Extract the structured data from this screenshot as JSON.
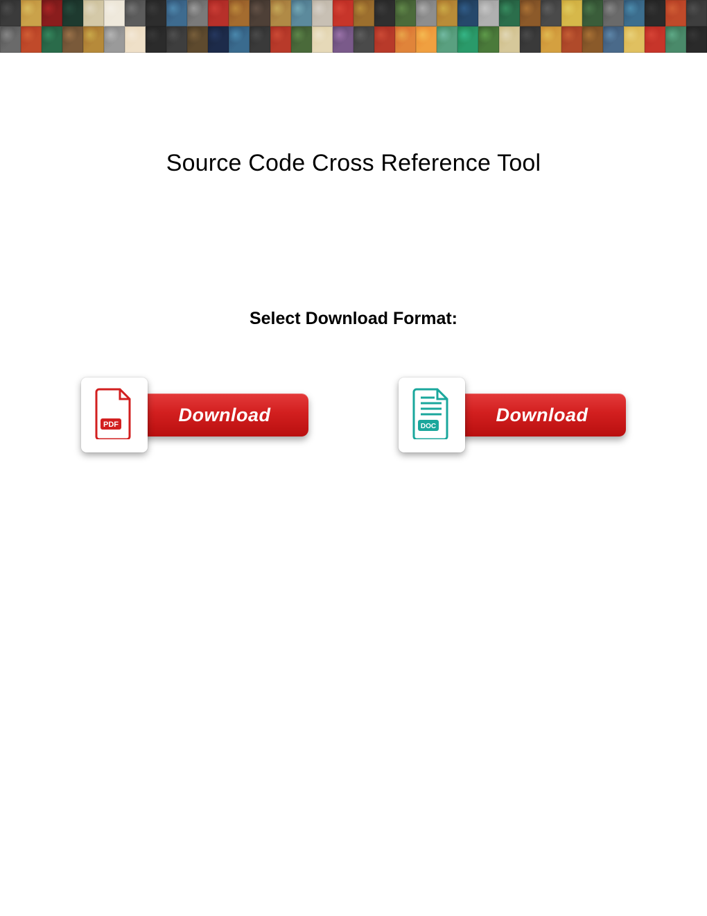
{
  "header": {
    "banner_tile_colors_row1": [
      "#3b3b3b",
      "#caa24a",
      "#8a1d1d",
      "#1e3a2f",
      "#d4c9a8",
      "#efe9dc",
      "#5c5c5c",
      "#2d2d2d",
      "#3e6b8f",
      "#7a7a7a",
      "#b7302a",
      "#a46c2f",
      "#4e4037",
      "#b08a46",
      "#5c8a9c",
      "#c8c0b4",
      "#c7352a",
      "#9c6f2e",
      "#2f2f2f",
      "#4c6b3a",
      "#8e8e8e",
      "#b98c38",
      "#26486b",
      "#b0b0b0",
      "#2b6e4b",
      "#8c5a2a",
      "#4a4a4a",
      "#d6b84a",
      "#3a5d3a",
      "#6a6a6a",
      "#3c6e8e",
      "#2a2a2a",
      "#c04a2a",
      "#3e3e3e"
    ],
    "banner_tile_colors_row2": [
      "#6a6a6a",
      "#c04a2a",
      "#2a6b4a",
      "#7a5a3a",
      "#b68a3a",
      "#9a9a9a",
      "#efe0c8",
      "#2b2b2b",
      "#3e3e3e",
      "#5e4a2e",
      "#1d2b4a",
      "#3a6b8e",
      "#3a3a3a",
      "#b83a2a",
      "#4a6a3a",
      "#e6d9b8",
      "#7a5a8a",
      "#4a4a4a",
      "#b83a2a",
      "#e0843a",
      "#f0a040",
      "#5aa080",
      "#2a9a6a",
      "#4a7a3a",
      "#d6c89a",
      "#3a3a3a",
      "#d4a040",
      "#b04a2a",
      "#8a5a2a",
      "#4a6a8a",
      "#e0c060",
      "#c7352a",
      "#4a8a6a",
      "#2a2a2a"
    ]
  },
  "main": {
    "title": "Source Code Cross Reference Tool",
    "subtitle": "Select Download Format:"
  },
  "downloads": {
    "pdf": {
      "icon_label": "PDF",
      "button_label": "Download",
      "accent": "#d21f1f"
    },
    "doc": {
      "icon_label": "DOC",
      "button_label": "Download",
      "accent": "#1aa79c"
    }
  }
}
